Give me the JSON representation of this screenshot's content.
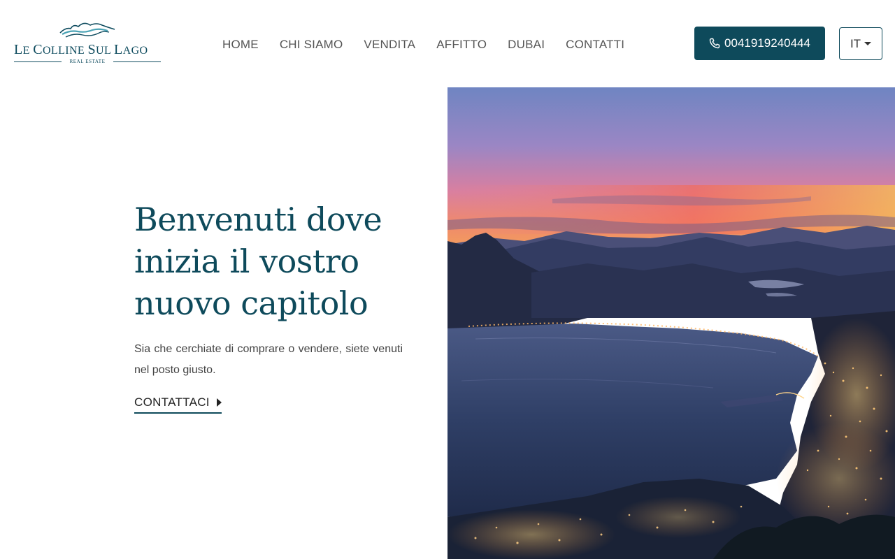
{
  "brand": {
    "name_first_l": "L",
    "name_first_rest": "E ",
    "name_c": "C",
    "name_olline": "OLLINE ",
    "name_s": "S",
    "name_ul": "UL ",
    "name_l": "L",
    "name_ago": "AGO",
    "subtitle": "REAL ESTATE"
  },
  "nav": {
    "items": [
      "HOME",
      "CHI SIAMO",
      "VENDITA",
      "AFFITTO",
      "DUBAI",
      "CONTATTI"
    ]
  },
  "header": {
    "phone": "0041919240444",
    "language": "IT"
  },
  "hero": {
    "title": "Benvenuti dove inizia il vostro nuovo capitolo",
    "text": "Sia che cerchiate di comprare o vendere, siete venuti nel posto giusto.",
    "cta": "CONTATTACI"
  },
  "colors": {
    "primary": "#0e4a5b",
    "logo_accent": "#4aa3b5"
  },
  "icons": {
    "phone": "phone-icon",
    "caret": "caret-down-icon",
    "cta_arrow": "caret-right-icon"
  }
}
